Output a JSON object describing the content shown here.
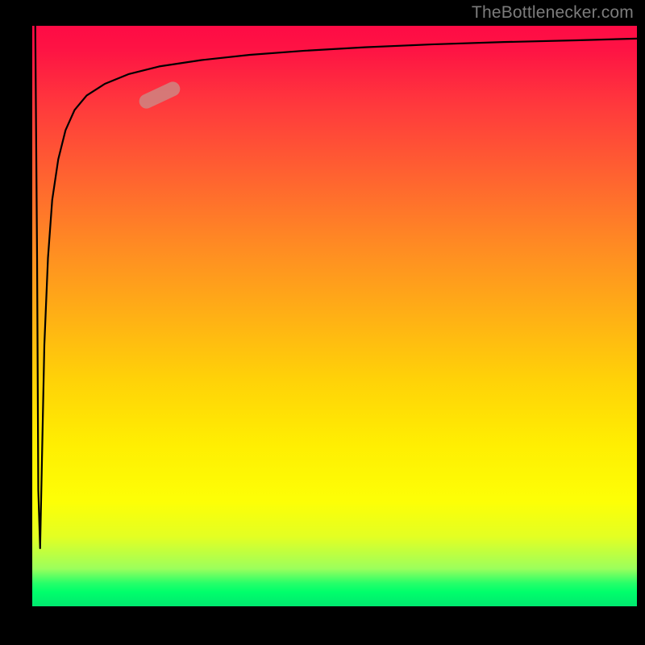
{
  "attribution": "TheBottlenecker.com",
  "colors": {
    "axes": "#000000",
    "curve": "#000000",
    "marker": "rgba(208,130,128,0.88)",
    "text": "#7c7c7c"
  },
  "chart_data": {
    "type": "line",
    "title": "",
    "xlabel": "",
    "ylabel": "",
    "xlim": [
      0,
      100
    ],
    "ylim": [
      0,
      100
    ],
    "grid": false,
    "legend": false,
    "background_gradient": "vertical red→orange→yellow→green (top→bottom) indicating severity; green≈0, red≈100",
    "series": [
      {
        "name": "bottleneck-curve",
        "x": [
          0.5,
          0.8,
          1.0,
          1.3,
          1.6,
          2.0,
          2.6,
          3.3,
          4.3,
          5.5,
          7.0,
          9.0,
          12,
          16,
          21,
          28,
          36,
          45,
          55,
          66,
          78,
          90,
          100
        ],
        "y": [
          100,
          60,
          20,
          10,
          25,
          45,
          60,
          70,
          77,
          82,
          85.5,
          88,
          90,
          91.7,
          93,
          94.1,
          95,
          95.7,
          96.3,
          96.8,
          97.2,
          97.5,
          97.8
        ]
      }
    ],
    "annotations": [
      {
        "name": "highlight-segment",
        "shape": "pill",
        "approx_x": 21,
        "approx_y": 88,
        "angle_deg": -25
      }
    ]
  }
}
